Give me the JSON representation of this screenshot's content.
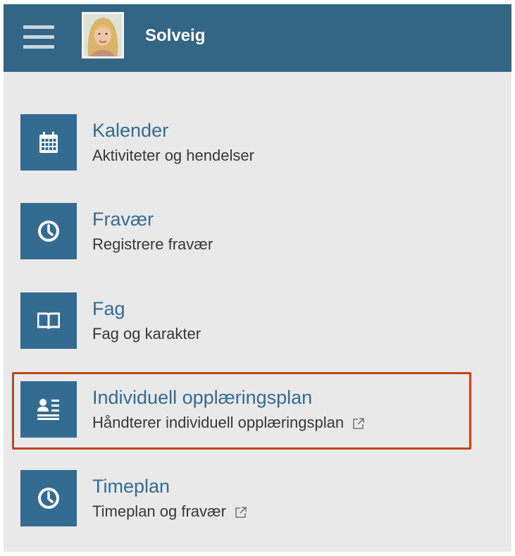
{
  "header": {
    "user_name": "Solveig",
    "menu_icon": "hamburger-menu-icon",
    "avatar": "user-avatar",
    "bg_color": "#336585"
  },
  "menu": {
    "items": [
      {
        "id": "kalender",
        "icon": "calendar-icon",
        "title": "Kalender",
        "subtitle": "Aktiviteter og hendelser",
        "external": false
      },
      {
        "id": "fravaer",
        "icon": "clock-icon",
        "title": "Fravær",
        "subtitle": "Registrere fravær",
        "external": false
      },
      {
        "id": "fag",
        "icon": "book-icon",
        "title": "Fag",
        "subtitle": "Fag og karakter",
        "external": false
      },
      {
        "id": "iop",
        "icon": "individual-plan-icon",
        "title": "Individuell opplæringsplan",
        "subtitle": "Håndterer individuell opplæringsplan",
        "external": true,
        "highlighted": true
      },
      {
        "id": "timeplan",
        "icon": "clock-icon",
        "title": "Timeplan",
        "subtitle": "Timeplan og fravær",
        "external": true
      }
    ]
  },
  "colors": {
    "accent": "#336b91",
    "background": "#e9e9e9",
    "highlight_border": "#c1441b"
  }
}
